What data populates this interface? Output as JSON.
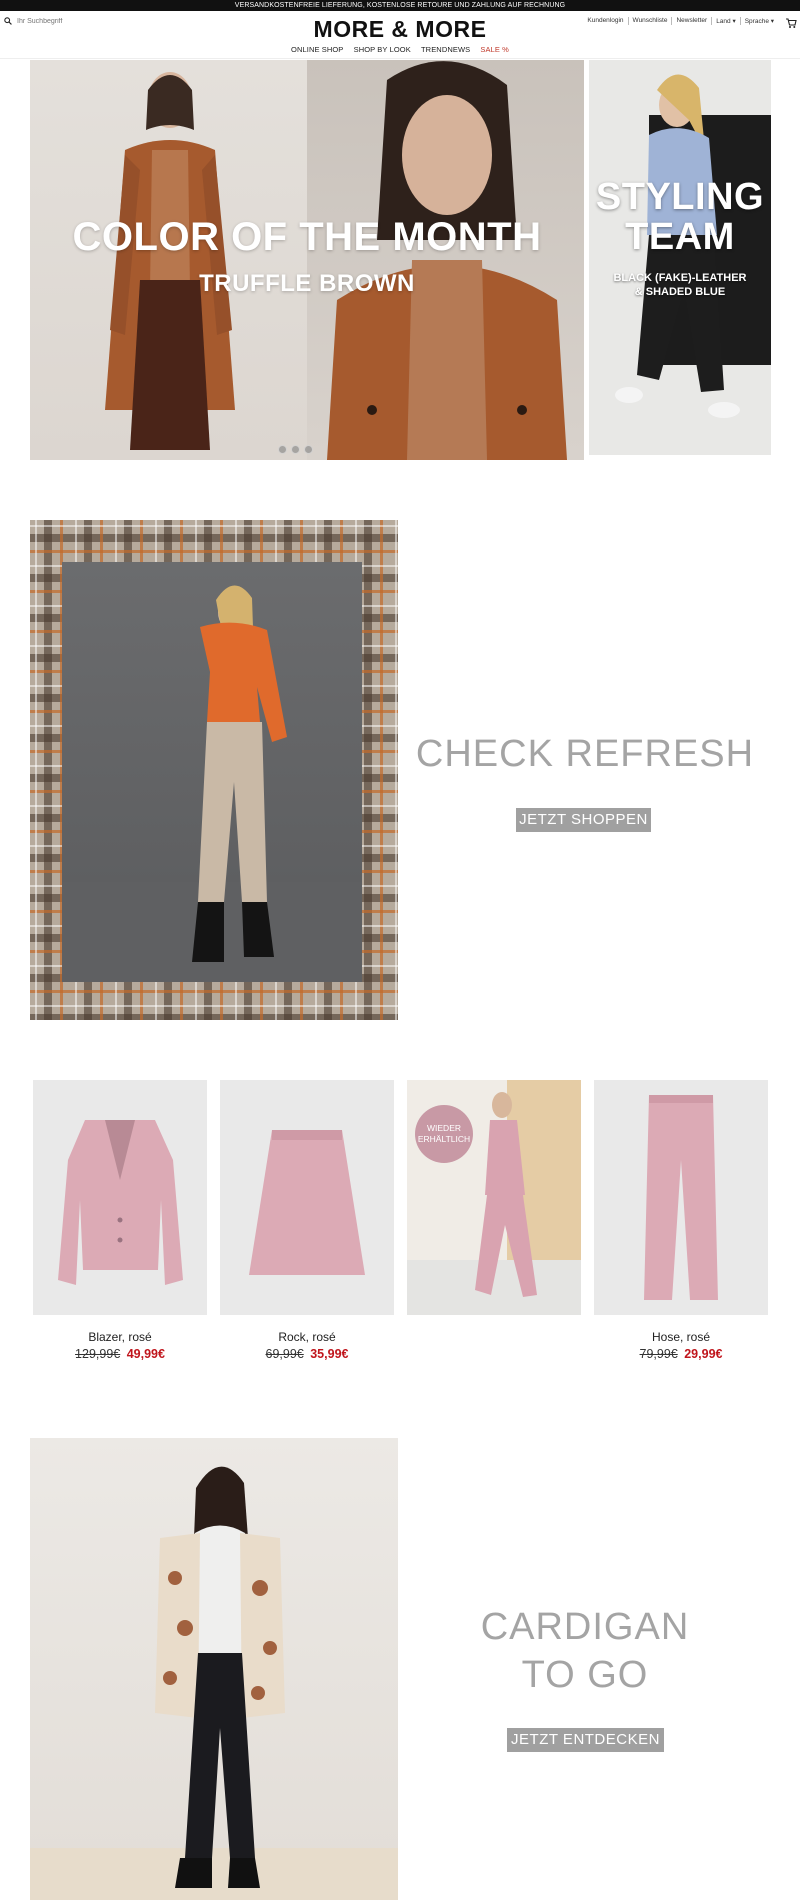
{
  "topbar": {
    "text": "VERSANDKOSTENFREIE LIEFERUNG, KOSTENLOSE RETOURE UND ZAHLUNG AUF RECHNUNG"
  },
  "header": {
    "search_placeholder": "Ihr Suchbegriff",
    "logo": "MORE & MORE",
    "nav": [
      "ONLINE SHOP",
      "SHOP BY LOOK",
      "TRENDNEWS"
    ],
    "sale_label": "SALE %",
    "sale_color": "#c0392b",
    "util": [
      "Kundenlogin",
      "Wunschliste",
      "Newsletter",
      "Land ▾",
      "Sprache ▾"
    ],
    "icons": {
      "search": "search-icon",
      "cart": "cart-icon"
    }
  },
  "hero": {
    "title": "COLOR OF THE MONTH",
    "subtitle": "TRUFFLE BROWN",
    "slides": 3,
    "color": "#9a5a32"
  },
  "styling": {
    "title_line1": "STYLING",
    "title_line2": "TEAM",
    "sub_line1": "BLACK (FAKE)-LEATHER",
    "sub_line2": "& SHADED BLUE"
  },
  "check": {
    "title": "CHECK REFRESH",
    "button": "JETZT SHOPPEN"
  },
  "products": [
    {
      "name": "Blazer, rosé",
      "old_price": "129,99€",
      "new_price": "49,99€"
    },
    {
      "name": "Rock, rosé",
      "old_price": "69,99€",
      "new_price": "35,99€"
    },
    {
      "name": "",
      "old_price": "",
      "new_price": "",
      "badge": "WIEDER ERHÄLTLICH"
    },
    {
      "name": "Hose, rosé",
      "old_price": "79,99€",
      "new_price": "29,99€"
    }
  ],
  "cardigan": {
    "title_line1": "CARDIGAN",
    "title_line2": "TO GO",
    "button": "JETZT ENTDECKEN"
  },
  "colors": {
    "accent_sale": "#c0151c",
    "button_grey": "#a0a0a0",
    "rose": "#dcaab5"
  }
}
